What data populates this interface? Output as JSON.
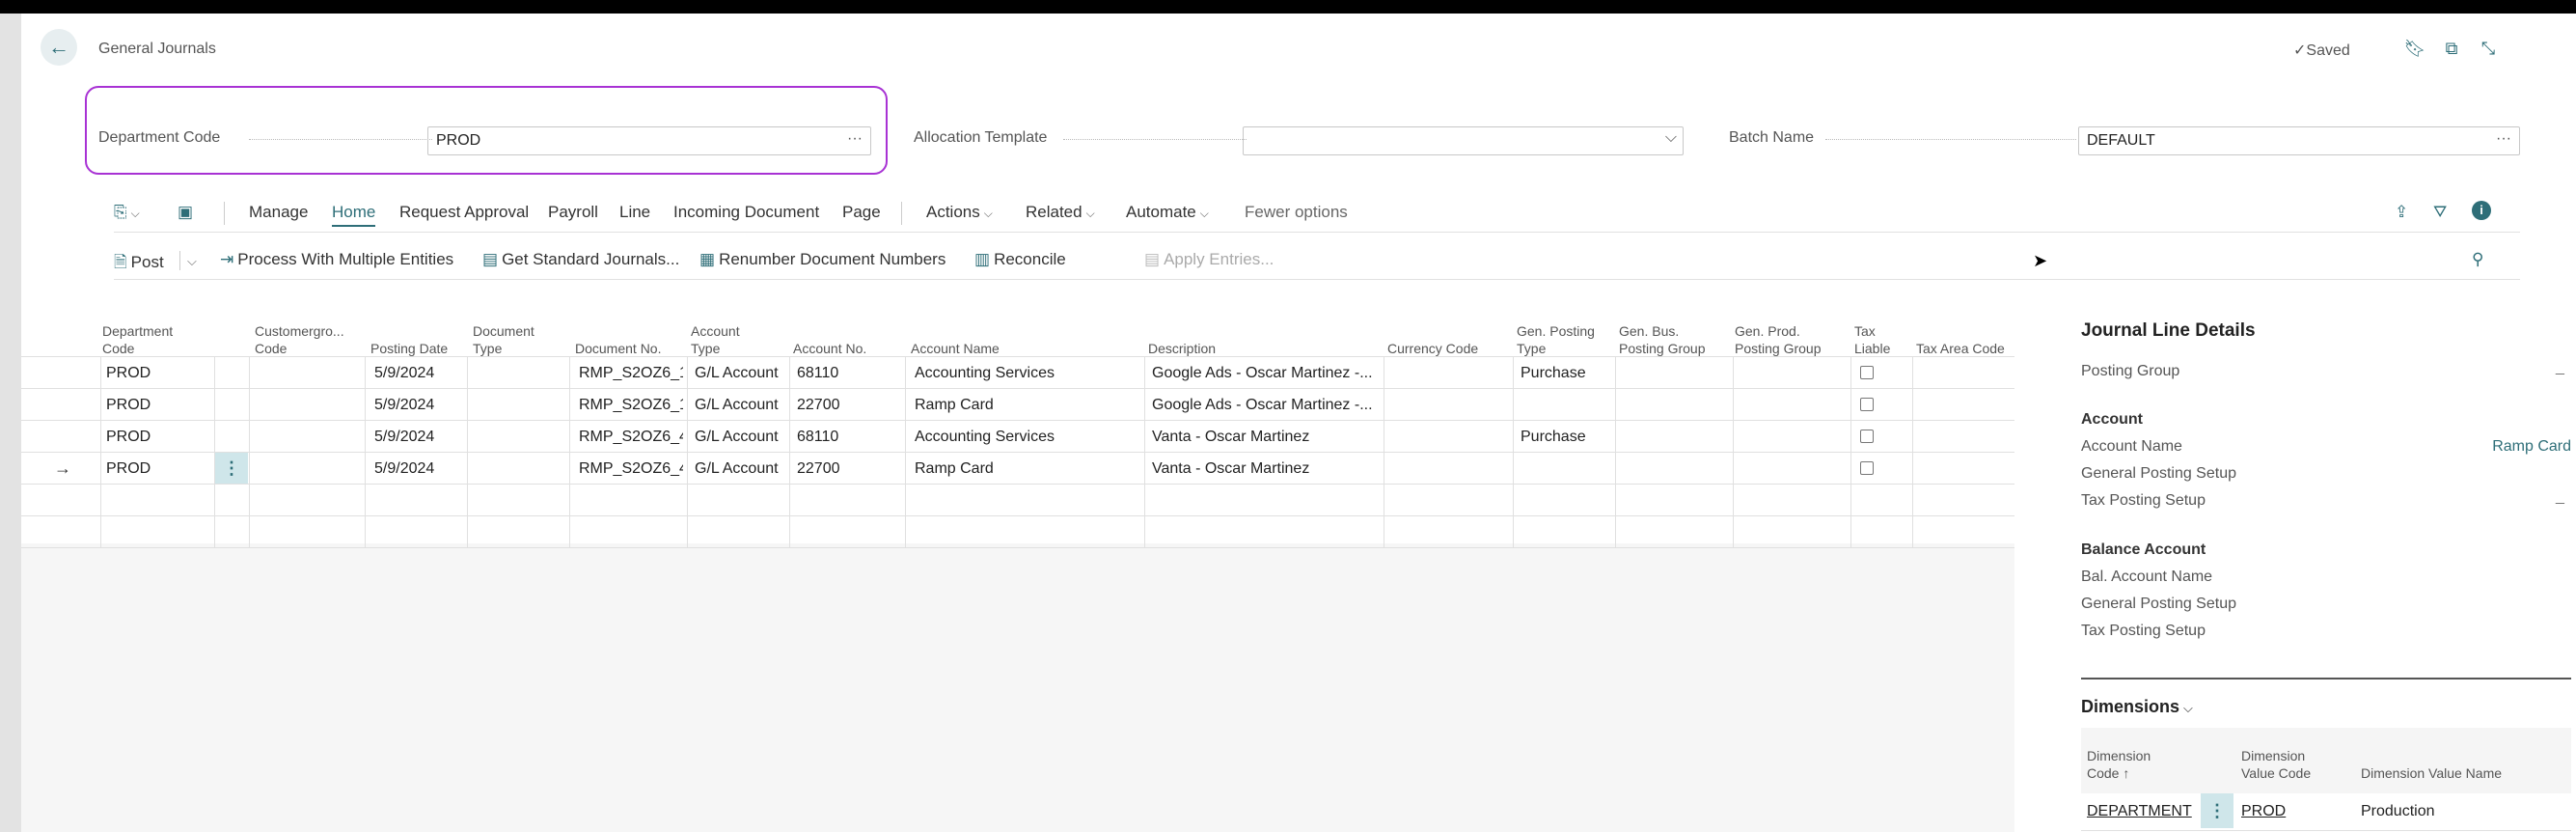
{
  "header": {
    "title": "General Journals",
    "saved_label": "Saved",
    "icons": [
      "back-arrow-icon",
      "bookmark-icon",
      "open-in-new-window-icon",
      "collapse-icon"
    ]
  },
  "fields": {
    "department_code": {
      "label": "Department Code",
      "value": "PROD",
      "ellipsis": "···"
    },
    "allocation_template": {
      "label": "Allocation Template",
      "value": ""
    },
    "batch_name": {
      "label": "Batch Name",
      "value": "DEFAULT",
      "ellipsis": "···"
    }
  },
  "menu": {
    "items": [
      "Manage",
      "Home",
      "Request Approval",
      "Payroll",
      "Line",
      "Incoming Document",
      "Page"
    ],
    "active": "Home",
    "dropdowns": [
      "Actions",
      "Related",
      "Automate"
    ],
    "fewer_options": "Fewer options"
  },
  "actions": {
    "post": "Post",
    "process_multiple": "Process With Multiple Entities",
    "get_standard": "Get Standard Journals...",
    "renumber": "Renumber Document Numbers",
    "reconcile": "Reconcile",
    "apply_entries": "Apply Entries..."
  },
  "grid": {
    "columns": [
      [
        "Department",
        "Code"
      ],
      [
        "Customergro...",
        "Code"
      ],
      [
        "Posting Date",
        ""
      ],
      [
        "Document",
        "Type"
      ],
      [
        "Document No.",
        ""
      ],
      [
        "Account",
        "Type"
      ],
      [
        "Account No.",
        ""
      ],
      [
        "Account Name",
        ""
      ],
      [
        "Description",
        ""
      ],
      [
        "Currency Code",
        ""
      ],
      [
        "Gen. Posting",
        "Type"
      ],
      [
        "Gen. Bus.",
        "Posting Group"
      ],
      [
        "Gen. Prod.",
        "Posting Group"
      ],
      [
        "Tax",
        "Liable"
      ],
      [
        "Tax Area Code",
        ""
      ]
    ],
    "rows": [
      {
        "dept": "PROD",
        "date": "5/9/2024",
        "doc_no": "RMP_S2OZ6_1",
        "acct_type": "G/L Account",
        "acct_no": "68110",
        "acct_name": "Accounting Services",
        "desc": "Google Ads - Oscar Martinez -...",
        "gen_posting": "Purchase"
      },
      {
        "dept": "PROD",
        "date": "5/9/2024",
        "doc_no": "RMP_S2OZ6_1",
        "acct_type": "G/L Account",
        "acct_no": "22700",
        "acct_name": "Ramp Card",
        "desc": "Google Ads - Oscar Martinez -...",
        "gen_posting": ""
      },
      {
        "dept": "PROD",
        "date": "5/9/2024",
        "doc_no": "RMP_S2OZ6_4",
        "acct_type": "G/L Account",
        "acct_no": "68110",
        "acct_name": "Accounting Services",
        "desc": "Vanta - Oscar Martinez",
        "gen_posting": "Purchase"
      },
      {
        "dept": "PROD",
        "date": "5/9/2024",
        "doc_no": "RMP_S2OZ6_4",
        "acct_type": "G/L Account",
        "acct_no": "22700",
        "acct_name": "Ramp Card",
        "desc": "Vanta - Oscar Martinez",
        "gen_posting": ""
      }
    ],
    "current_row_marker": "→",
    "row_menu": "⋮"
  },
  "side": {
    "title": "Journal Line Details",
    "posting_group": "Posting Group",
    "account_group": "Account",
    "account_name": "Account Name",
    "account_name_value": "Ramp Card",
    "general_posting_setup": "General Posting Setup",
    "tax_posting_setup": "Tax Posting Setup",
    "balance_group": "Balance Account",
    "bal_account_name": "Bal. Account Name",
    "bal_general_posting_setup": "General Posting Setup",
    "bal_tax_posting_setup": "Tax Posting Setup",
    "dash": "_",
    "dimensions_title": "Dimensions",
    "dim_columns": [
      [
        "Dimension",
        "Code ↑"
      ],
      [
        "Dimension",
        "Value Code"
      ],
      [
        "",
        "Dimension Value Name"
      ]
    ],
    "dim_row": {
      "code": "DEPARTMENT",
      "value_code": "PROD",
      "value_name": "Production"
    }
  }
}
